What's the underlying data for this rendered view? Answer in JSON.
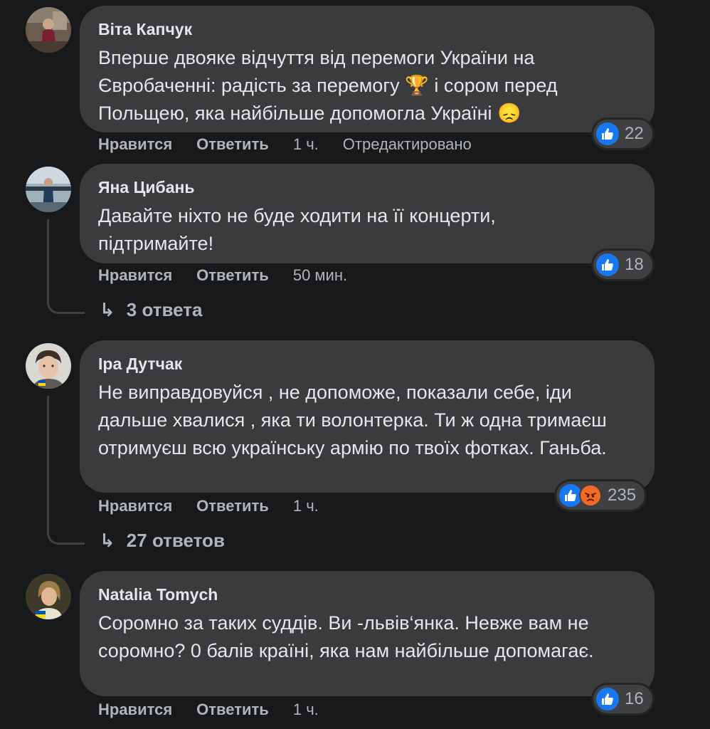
{
  "comments": [
    {
      "author": "Віта Капчук",
      "text_before": "Вперше двояке відчуття від перемоги України на Євробаченні: радість за перемогу",
      "emoji1": "🏆",
      "text_middle": "і сором перед Польщею, яка найбільше допомогла Україні",
      "emoji2": "😞",
      "like_label": "Нравится",
      "reply_label": "Ответить",
      "time": "1 ч.",
      "edited": "Отредактировано",
      "reactions": "22"
    },
    {
      "author": "Яна Цибань",
      "text": "Давайте ніхто не буде ходити на її концерти, підтримайте!",
      "like_label": "Нравится",
      "reply_label": "Ответить",
      "time": "50 мин.",
      "reactions": "18",
      "replies": "3 ответа"
    },
    {
      "author": "Іра Дутчак",
      "text": "Не виправдовуйся , не допоможе, показали себе, іди дальше хвалися , яка ти волонтерка. Ти ж одна тримаєш отримуєш всю українську армію по твоїх фотках. Ганьба.",
      "like_label": "Нравится",
      "reply_label": "Ответить",
      "time": "1 ч.",
      "reactions": "235",
      "replies": "27 ответов"
    },
    {
      "author": "Natalia Tomych",
      "text": "Соромно за таких суддів. Ви -львів‘янка. Невже вам не соромно? 0 балів країні, яка нам найбільше допомагає.",
      "like_label": "Нравится",
      "reply_label": "Ответить",
      "time": "1 ч.",
      "reactions": "16"
    }
  ],
  "icons": {
    "like": "like-icon",
    "angry": "angry-icon",
    "reply_arrow": "reply-arrow-icon"
  },
  "colors": {
    "background": "#18191a",
    "bubble": "#3a3b3c",
    "like_blue": "#1877f2",
    "angry_orange": "#f46a24"
  }
}
